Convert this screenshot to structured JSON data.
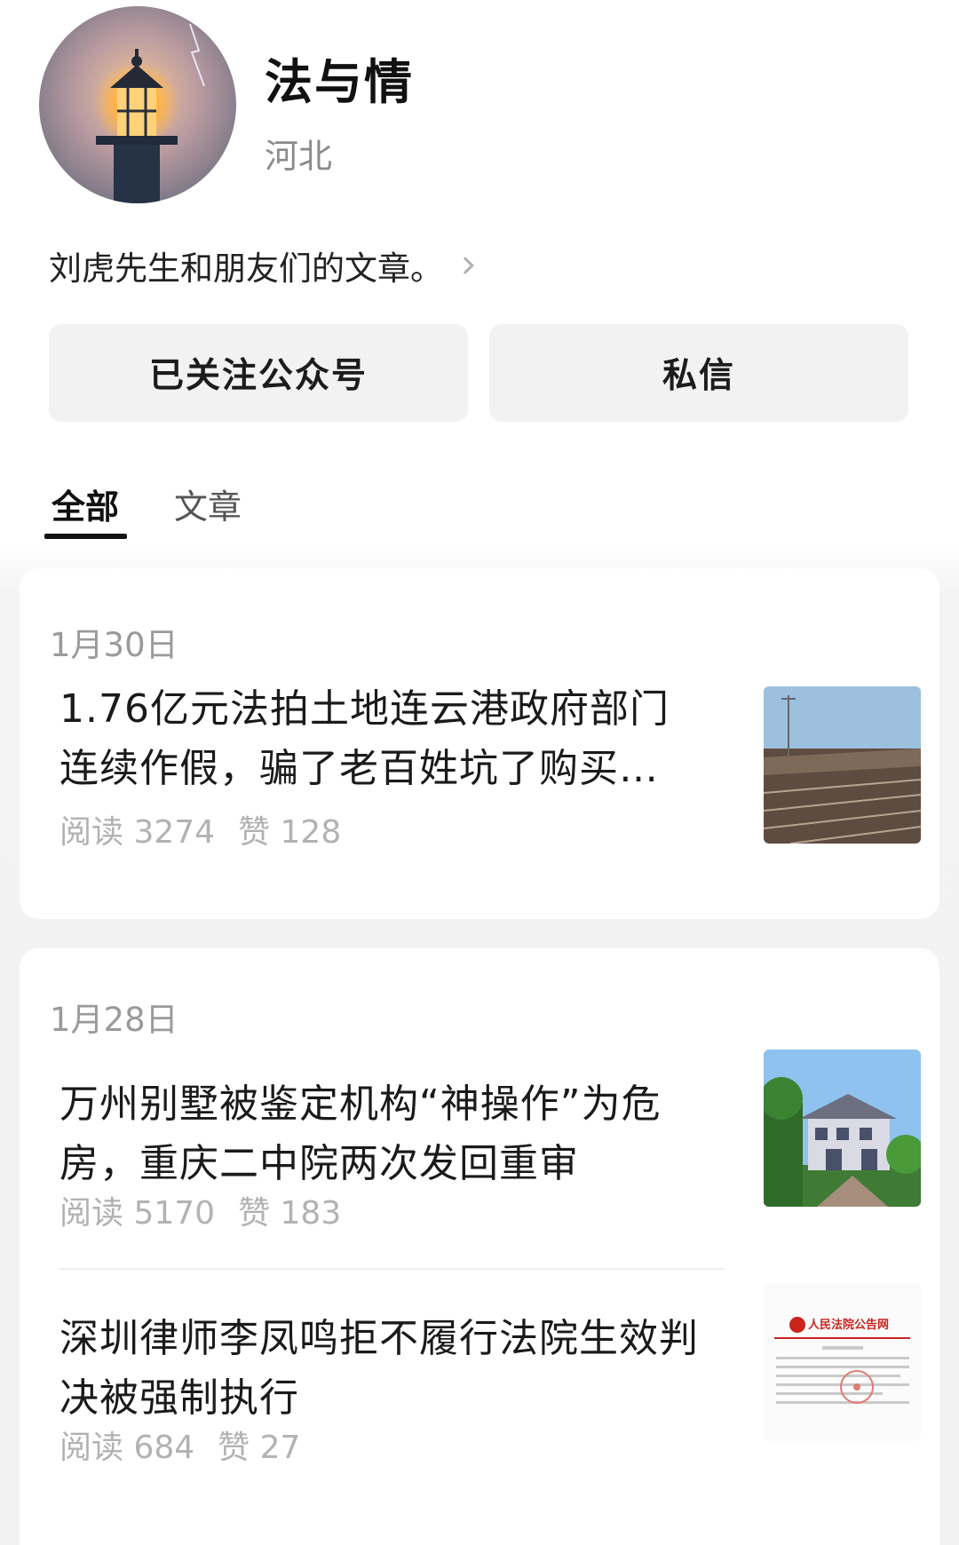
{
  "profile": {
    "name": "法与情",
    "region": "河北",
    "bio": "刘虎先生和朋友们的文章。"
  },
  "actions": {
    "follow_label": "已关注公众号",
    "message_label": "私信"
  },
  "tabs": [
    {
      "label": "全部",
      "active": true
    },
    {
      "label": "文章",
      "active": false
    }
  ],
  "feed": [
    {
      "date": "1月30日",
      "articles": [
        {
          "title": "1.76亿元法拍土地连云港政府部门连续作假，骗了老百姓坑了购买…",
          "reads": "阅读 3274",
          "likes": "赞 128",
          "thumb_icon": "farmland-thumbnail"
        }
      ]
    },
    {
      "date": "1月28日",
      "articles": [
        {
          "title": "万州别墅被鉴定机构“神操作”为危房，重庆二中院两次发回重审",
          "reads": "阅读 5170",
          "likes": "赞 183",
          "thumb_icon": "villa-thumbnail"
        },
        {
          "title": "深圳律师李凤鸣拒不履行法院生效判决被强制执行",
          "reads": "阅读 684",
          "likes": "赞 27",
          "thumb_icon": "court-notice-thumbnail",
          "thumb_text": "人民法院公告网"
        }
      ]
    }
  ],
  "colors": {
    "button_bg": "#f2f2f2",
    "feed_bg": "#f2f2f2",
    "muted_text": "#9a9a9a",
    "court_red": "#c8241c"
  }
}
